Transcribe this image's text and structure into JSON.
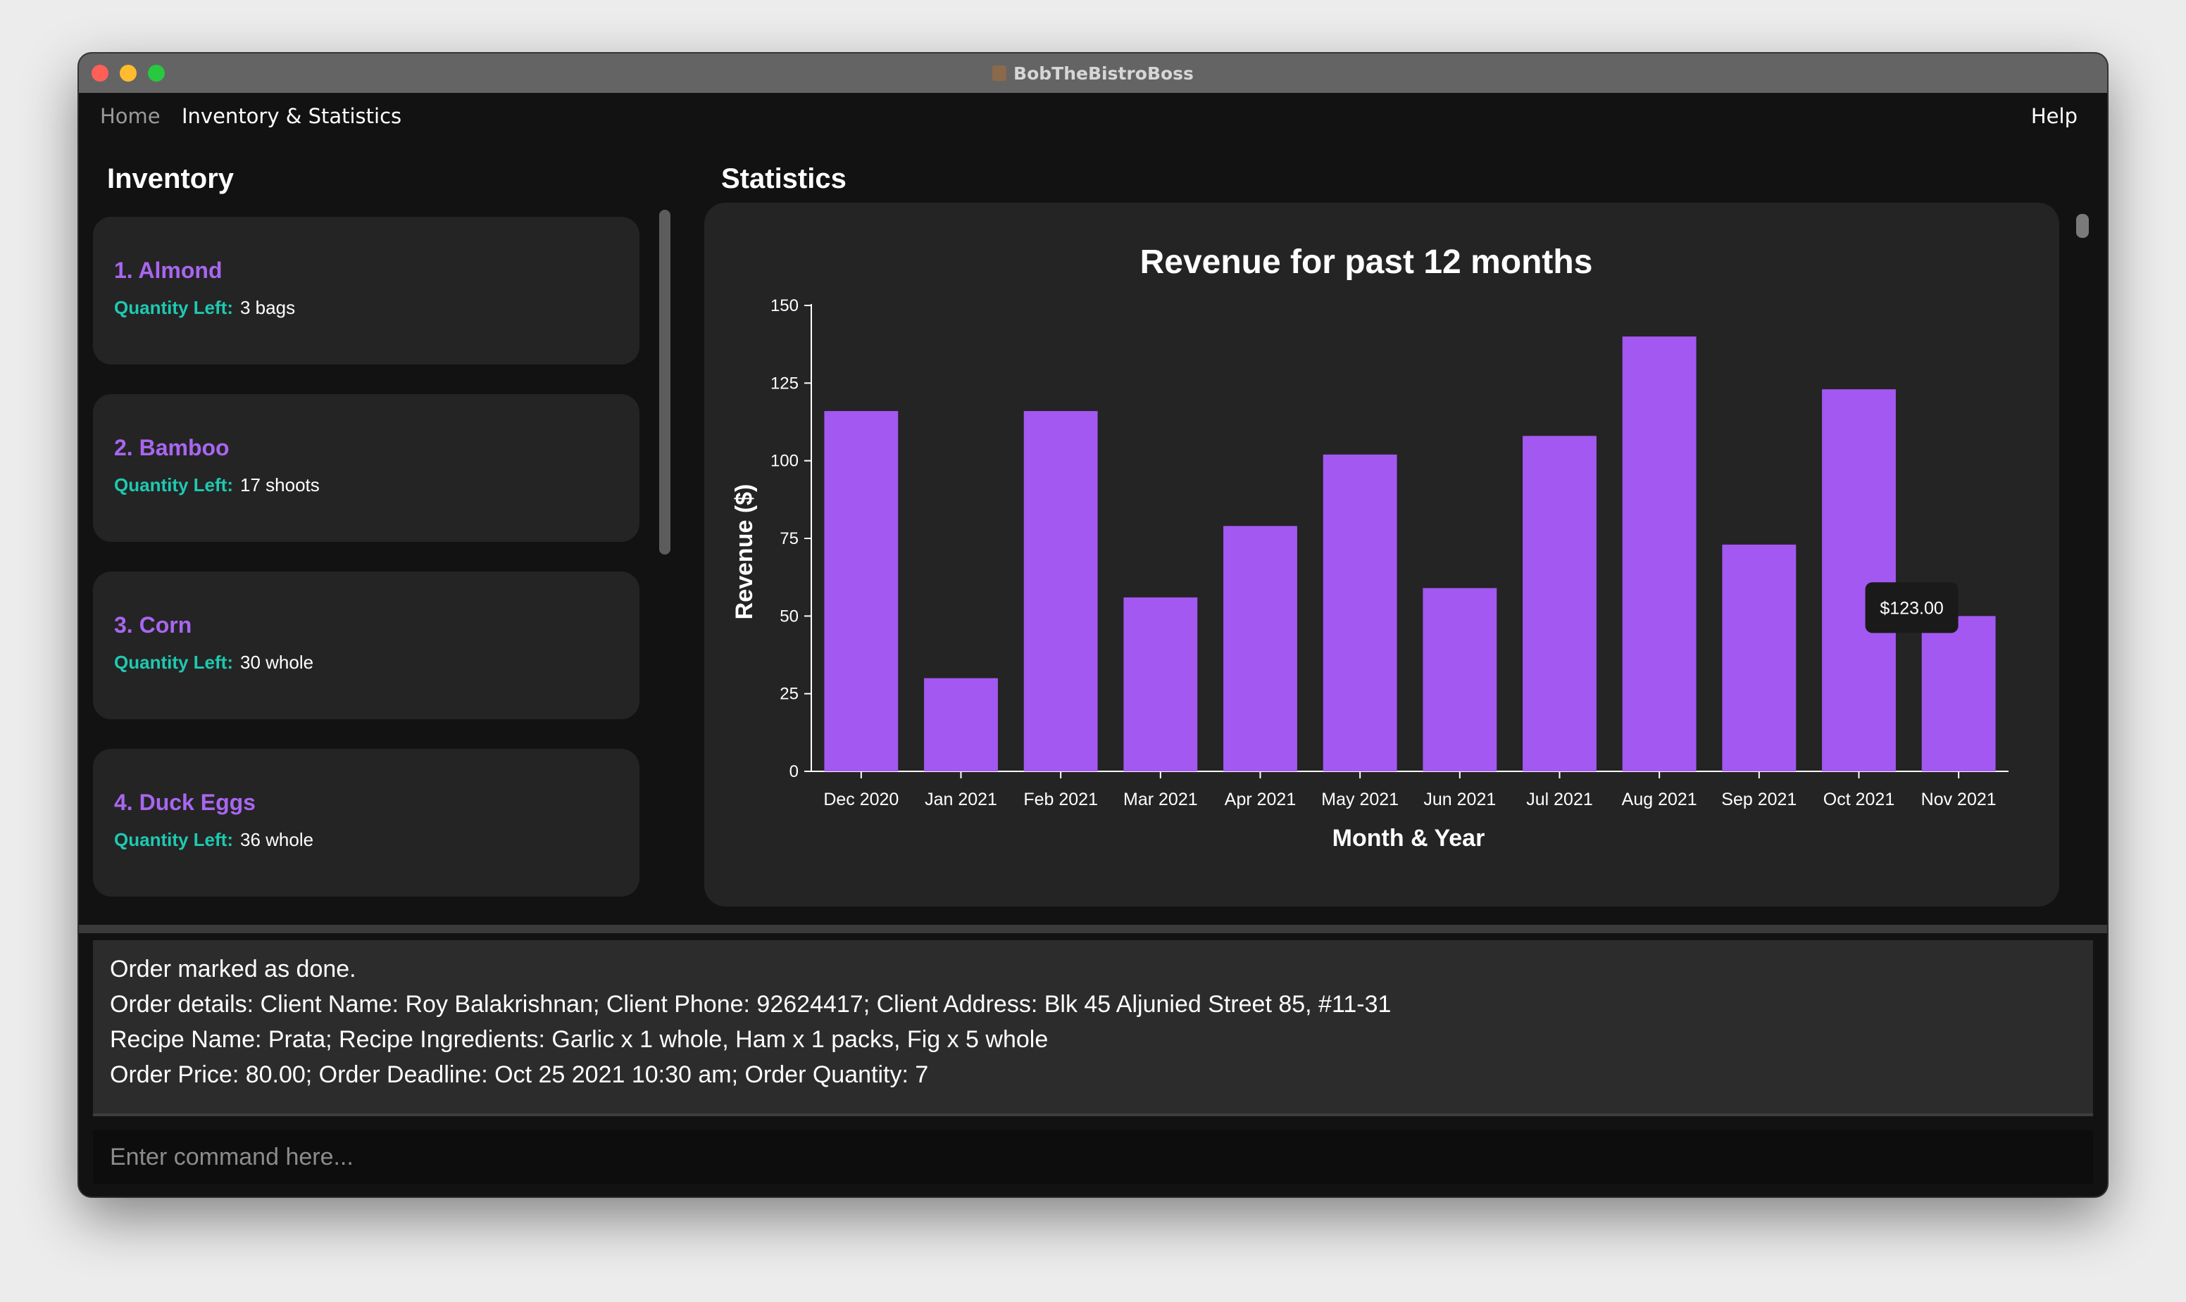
{
  "window": {
    "title": "BobTheBistroBoss"
  },
  "menu": {
    "home": "Home",
    "inventory_statistics": "Inventory & Statistics",
    "help": "Help"
  },
  "inventory": {
    "title": "Inventory",
    "qty_label": "Quantity Left:",
    "items": [
      {
        "name": "1.  Almond",
        "quantity": "3 bags"
      },
      {
        "name": "2.  Bamboo",
        "quantity": "17 shoots"
      },
      {
        "name": "3.  Corn",
        "quantity": "30 whole"
      },
      {
        "name": "4.  Duck Eggs",
        "quantity": "36 whole"
      }
    ]
  },
  "statistics": {
    "title": "Statistics",
    "tooltip": "$123.00"
  },
  "chart_data": {
    "type": "bar",
    "title": "Revenue for past 12 months",
    "xlabel": "Month & Year",
    "ylabel": "Revenue ($)",
    "ylim": [
      0,
      150
    ],
    "yticks": [
      0,
      25,
      50,
      75,
      100,
      125,
      150
    ],
    "grid": false,
    "bar_color": "#a358f1",
    "categories": [
      "Dec 2020",
      "Jan 2021",
      "Feb 2021",
      "Mar 2021",
      "Apr 2021",
      "May 2021",
      "Jun 2021",
      "Jul 2021",
      "Aug 2021",
      "Sep 2021",
      "Oct 2021",
      "Nov 2021"
    ],
    "values": [
      116,
      30,
      116,
      56,
      79,
      102,
      59,
      108,
      140,
      73,
      123,
      50
    ]
  },
  "result": {
    "lines": [
      "Order marked as done.",
      "Order details: Client Name: Roy Balakrishnan; Client Phone: 92624417; Client Address: Blk 45 Aljunied Street 85, #11-31",
      "Recipe Name: Prata; Recipe Ingredients: Garlic x 1 whole, Ham x 1 packs, Fig x 5 whole",
      "Order Price: 80.00; Order Deadline: Oct 25 2021 10:30 am; Order Quantity: 7"
    ]
  },
  "command": {
    "placeholder": "Enter command here..."
  },
  "colors": {
    "accent_purple": "#a866f0",
    "accent_teal": "#1ec9b1",
    "bar": "#a358f1"
  }
}
